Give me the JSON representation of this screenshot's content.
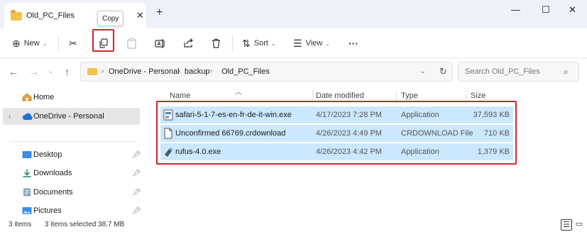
{
  "window": {
    "tab_title": "Old_PC_Files",
    "tab_close_glyph": "✕",
    "new_tab_glyph": "+",
    "minimize_glyph": "—",
    "maximize_glyph": "☐",
    "close_glyph": "✕",
    "tooltip": "Copy"
  },
  "toolbar": {
    "new_label": "New",
    "sort_label": "Sort",
    "view_label": "View",
    "more_glyph": "···"
  },
  "address": {
    "crumbs": [
      "OneDrive - Personal",
      "backup",
      "Old_PC_Files"
    ],
    "search_placeholder": "Search Old_PC_Files"
  },
  "sidebar": {
    "items": [
      {
        "label": "Home",
        "icon": "home-icon"
      },
      {
        "label": "OneDrive - Personal",
        "icon": "cloud-icon"
      },
      {
        "label": "Desktop",
        "icon": "desktop-icon"
      },
      {
        "label": "Downloads",
        "icon": "download-icon"
      },
      {
        "label": "Documents",
        "icon": "document-icon"
      },
      {
        "label": "Pictures",
        "icon": "pictures-icon"
      }
    ]
  },
  "columns": {
    "name": "Name",
    "date": "Date modified",
    "type": "Type",
    "size": "Size"
  },
  "files": [
    {
      "name": "safari-5-1-7-es-en-fr-de-it-win.exe",
      "date": "4/17/2023 7:28 PM",
      "type": "Application",
      "size": "37,593 KB",
      "icon": "installer-icon"
    },
    {
      "name": "Unconfirmed 66769.crdownload",
      "date": "4/26/2023 4:49 PM",
      "type": "CRDOWNLOAD File",
      "size": "710 KB",
      "icon": "blank-file-icon"
    },
    {
      "name": "rufus-4.0.exe",
      "date": "4/26/2023 4:42 PM",
      "type": "Application",
      "size": "1,379 KB",
      "icon": "usb-drive-icon"
    }
  ],
  "status": {
    "items_count": "3 items",
    "selection": "3 items selected  38.7 MB"
  },
  "colors": {
    "selection": "#cce8ff",
    "highlight_border": "#d4232c",
    "titlebar": "#eef1f7"
  }
}
